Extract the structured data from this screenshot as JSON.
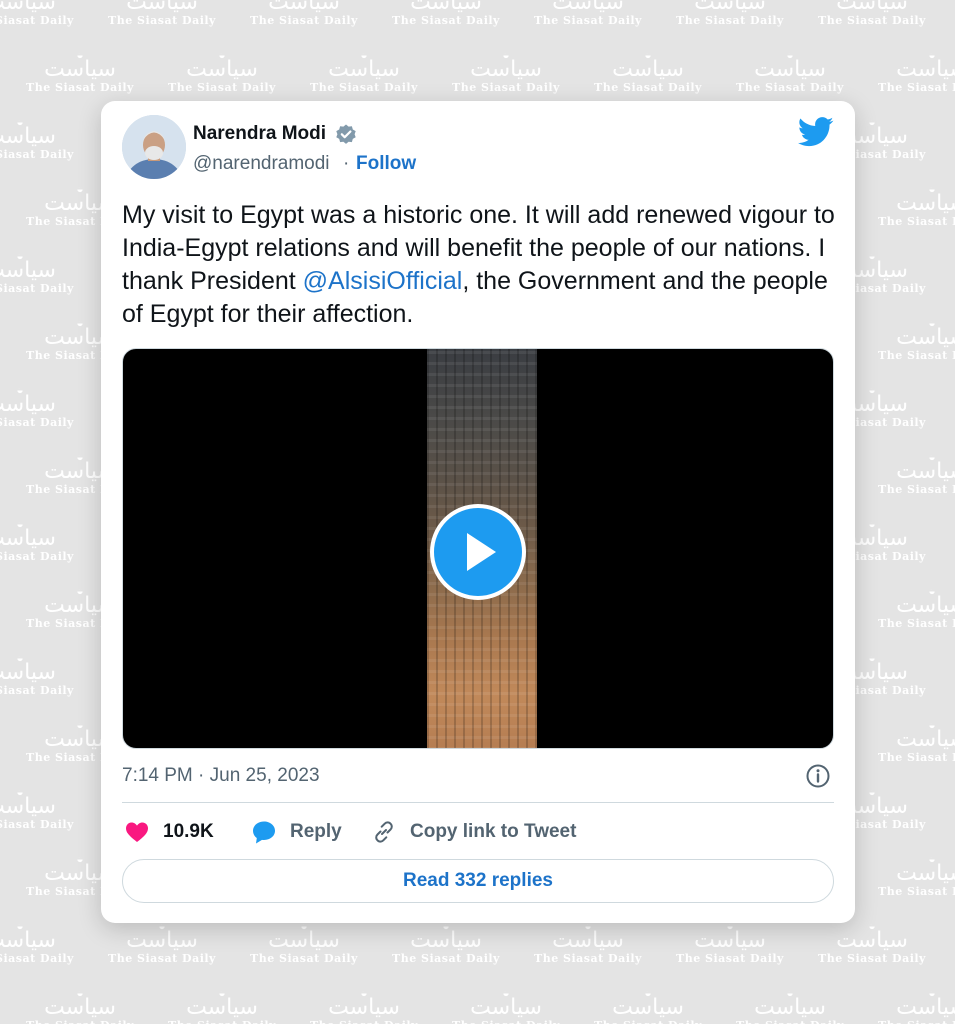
{
  "watermark": {
    "arabic_text": "سیاست",
    "english_text": "The Siasat Daily"
  },
  "tweet": {
    "author": {
      "name": "Narendra Modi",
      "handle": "@narendramodi",
      "verified": true,
      "avatar_icon": "profile-photo"
    },
    "follow_label": "Follow",
    "separator": "·",
    "text_segments": [
      {
        "text": "My visit to Egypt was a historic one. It will add renewed vigour to India-Egypt relations and will benefit the people of our nations. I thank President "
      },
      {
        "text": "@AlsisiOfficial",
        "mention": true
      },
      {
        "text": ", the Government and the people of Egypt for their affection."
      }
    ],
    "media": {
      "type": "video",
      "play_icon": "play-icon"
    },
    "timestamp": "7:14 PM · Jun 25, 2023",
    "actions": {
      "like_count": "10.9K",
      "reply_label": "Reply",
      "copy_link_label": "Copy link to Tweet"
    },
    "read_replies_label": "Read 332 replies"
  },
  "colors": {
    "accent_blue": "#1d73c9",
    "twitter_blue": "#1d9bf0",
    "like_pink": "#f91880",
    "text_primary": "#0f1419",
    "text_secondary": "#536471",
    "background": "#e4e4e4"
  }
}
